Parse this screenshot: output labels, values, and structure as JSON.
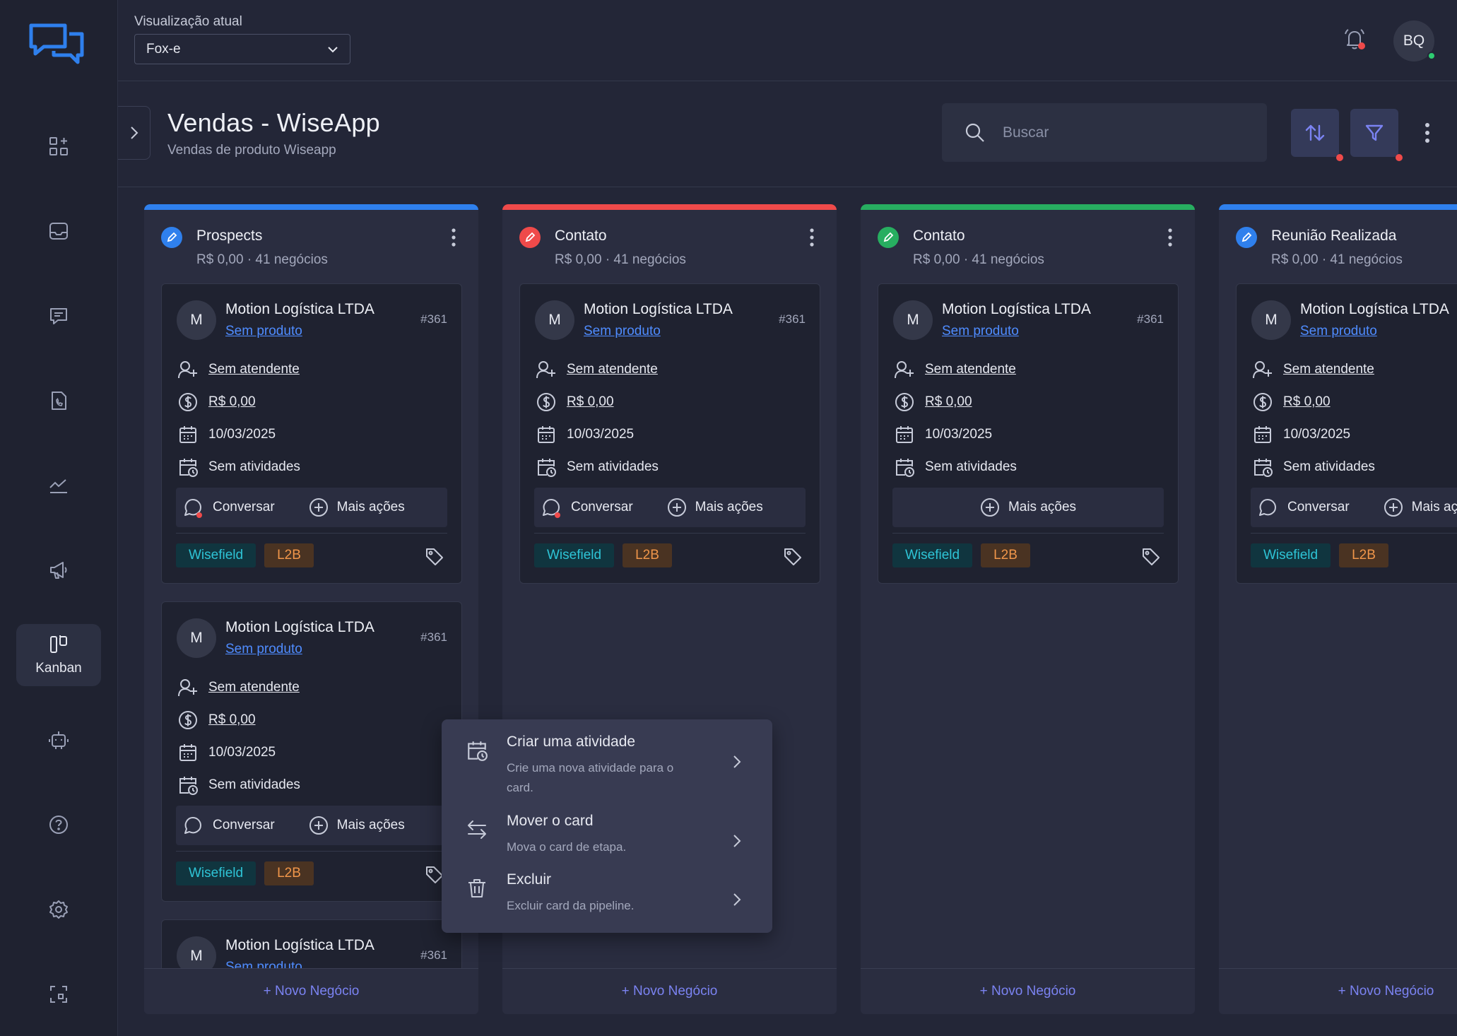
{
  "topbar": {
    "view_label": "Visualização atual",
    "view_selected": "Fox-e",
    "user_initials": "BQ"
  },
  "sidebar": {
    "items": [
      {
        "icon": "apps-add-icon",
        "label": ""
      },
      {
        "icon": "inbox-icon",
        "label": ""
      },
      {
        "icon": "chat-icon",
        "label": ""
      },
      {
        "icon": "phone-doc-icon",
        "label": ""
      },
      {
        "icon": "chart-icon",
        "label": ""
      },
      {
        "icon": "megaphone-icon",
        "label": ""
      },
      {
        "icon": "kanban-icon",
        "label": "Kanban"
      },
      {
        "icon": "robot-icon",
        "label": ""
      },
      {
        "icon": "help-icon",
        "label": ""
      },
      {
        "icon": "settings-icon",
        "label": ""
      },
      {
        "icon": "scan-icon",
        "label": ""
      }
    ]
  },
  "header": {
    "title": "Vendas - WiseApp",
    "subtitle": "Vendas de produto Wiseapp",
    "search_placeholder": "Buscar"
  },
  "colors": {
    "blue": "#2f80ed",
    "red": "#ef4a4a",
    "green": "#27ae60",
    "accent": "#7b83f2"
  },
  "columns": [
    {
      "title": "Prospects",
      "meta": "R$ 0,00 · 41 negócios",
      "footer": "+ Novo Negócio",
      "color": "blue"
    },
    {
      "title": "Contato",
      "meta": "R$ 0,00 · 41 negócios",
      "footer": "+ Novo Negócio",
      "color": "red"
    },
    {
      "title": "Contato",
      "meta": "R$ 0,00 · 41 negócios",
      "footer": "+ Novo Negócio",
      "color": "green"
    },
    {
      "title": "Reunião Realizada",
      "meta": "R$ 0,00 · 41 negócios",
      "footer": "+ Novo Negócio",
      "color": "blue"
    }
  ],
  "card": {
    "initial": "M",
    "name": "Motion Logística LTDA",
    "product": "Sem produto",
    "id": "#361",
    "attendant": "Sem atendente",
    "value": "R$ 0,00",
    "date": "10/03/2025",
    "activities": "Sem atividades",
    "chat_label": "Conversar",
    "more_label": "Mais ações",
    "tags": [
      "Wisefield",
      "L2B"
    ]
  },
  "context_menu": [
    {
      "title": "Criar uma atividade",
      "desc": "Crie uma nova atividade para o card.",
      "icon": "calendar-clock-icon"
    },
    {
      "title": "Mover o card",
      "desc": "Mova o card de etapa.",
      "icon": "move-arrows-icon"
    },
    {
      "title": "Excluir",
      "desc": "Excluir card da pipeline.",
      "icon": "trash-icon"
    }
  ]
}
